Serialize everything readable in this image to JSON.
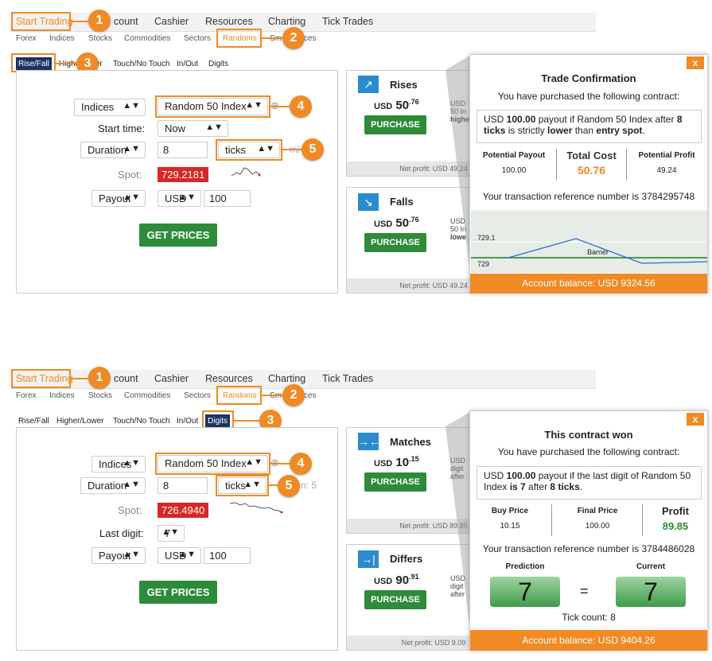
{
  "top_nav": {
    "start_trading": "Start Trading",
    "account_partial": "count",
    "cashier": "Cashier",
    "resources": "Resources",
    "charting": "Charting",
    "tick_trades": "Tick Trades"
  },
  "sub_nav": {
    "forex": "Forex",
    "indices": "Indices",
    "stocks": "Stocks",
    "commodities": "Commodities",
    "sectors": "Sectors",
    "randoms": "Randoms",
    "smart_partial_left": "Sm",
    "smart_partial_right": "ces"
  },
  "badges": {
    "one": "1",
    "two": "2",
    "three": "3",
    "four": "4",
    "five": "5"
  },
  "panel1": {
    "tabs": {
      "rise_fall": "Rise/Fall",
      "higher_left": "Higher",
      "higher_right": "er",
      "touch": "Touch/No Touch",
      "inout": "In/Out",
      "digits": "Digits"
    },
    "market_select": "Indices",
    "underlying": "Random 50 Index",
    "start_time_label": "Start time:",
    "start_time_value": "Now",
    "duration_label": "Duration",
    "duration_value": "8",
    "duration_unit": "ticks",
    "min_partial": "mi",
    "spot_label": "Spot:",
    "spot_value": "729.2181",
    "payout_label": "Payout",
    "currency": "USD",
    "amount": "100",
    "get_prices": "GET PRICES",
    "card1": {
      "title": "Rises",
      "currency": "USD",
      "price": "50",
      "cents": ".76",
      "desc": [
        "USD",
        "50 In",
        "highe"
      ],
      "purchase": "PURCHASE",
      "net": "Net profit: USD 49.24"
    },
    "card2": {
      "title": "Falls",
      "currency": "USD",
      "price": "50",
      "cents": ".76",
      "desc": [
        "USD",
        "50 In",
        "lowe"
      ],
      "purchase": "PURCHASE",
      "net": "Net profit: USD 49.24"
    },
    "popup": {
      "close": "x",
      "title": "Trade Confirmation",
      "subtitle": "You have purchased the following contract:",
      "contract_pre": "USD ",
      "contract_amount": "100.00",
      "contract_mid": " payout if Random 50 Index after ",
      "contract_ticks": "8 ticks",
      "contract_mid2": " is strictly ",
      "contract_dir": "lower",
      "contract_than": " than ",
      "contract_spot": "entry spot",
      "contract_end": ".",
      "col1_head": "Potential Payout",
      "col1_val": "100.00",
      "col2_head": "Total Cost",
      "col2_val": "50.76",
      "col3_head": "Potential Profit",
      "col3_val": "49.24",
      "reference": "Your transaction reference number is 3784295748",
      "chart_label_high": "729.1",
      "chart_label_low": "729",
      "barrier": "Barrier",
      "balance": "Account balance: USD 9324.56"
    }
  },
  "panel2": {
    "tabs": {
      "rise_fall": "Rise/Fall",
      "higher_lower": "Higher/Lower",
      "touch": "Touch/No Touch",
      "inout": "In/Out",
      "digits": "Digits"
    },
    "market_select": "Indices",
    "underlying": "Random 50 Index",
    "duration_label": "Duration",
    "duration_value": "8",
    "duration_unit": "ticks",
    "min_partial": "n: 5",
    "spot_label": "Spot:",
    "spot_value": "726.4940",
    "last_digit_label": "Last digit:",
    "last_digit_value": "7",
    "payout_label": "Payout",
    "currency": "USD",
    "amount": "100",
    "get_prices": "GET PRICES",
    "card1": {
      "title": "Matches",
      "currency": "USD",
      "price": "10",
      "cents": ".15",
      "desc": [
        "USD",
        "digit",
        "after"
      ],
      "purchase": "PURCHASE",
      "net": "Net profit: USD 89.85"
    },
    "card2": {
      "title": "Differs",
      "currency": "USD",
      "price": "90",
      "cents": ".91",
      "desc": [
        "USD",
        "digit",
        "after"
      ],
      "purchase": "PURCHASE",
      "net": "Net profit: USD 9.09"
    },
    "popup": {
      "close": "x",
      "title": "This contract won",
      "subtitle": "You have purchased the following contract:",
      "contract_pre": "USD ",
      "contract_amount": "100.00",
      "contract_mid": " payout if the last digit of Random 50 Index ",
      "contract_is": "is 7",
      "contract_after": " after ",
      "contract_ticks": "8 ticks",
      "contract_end": ".",
      "col1_head": "Buy Price",
      "col1_val": "10.15",
      "col2_head": "Final Price",
      "col2_val": "100.00",
      "col3_head": "Profit",
      "col3_val": "89.85",
      "reference": "Your transaction reference number is 3784486028",
      "prediction_label": "Prediction",
      "current_label": "Current",
      "prediction_value": "7",
      "equals": "=",
      "current_value": "7",
      "tick_count": "Tick count: 8",
      "balance": "Account balance: USD 9404.26"
    }
  },
  "colors": {
    "accent": "#f08a24",
    "green": "#2e8b3a",
    "navy": "#1d3461",
    "spot_red": "#d62828",
    "icon_blue": "#2a8bd0"
  }
}
